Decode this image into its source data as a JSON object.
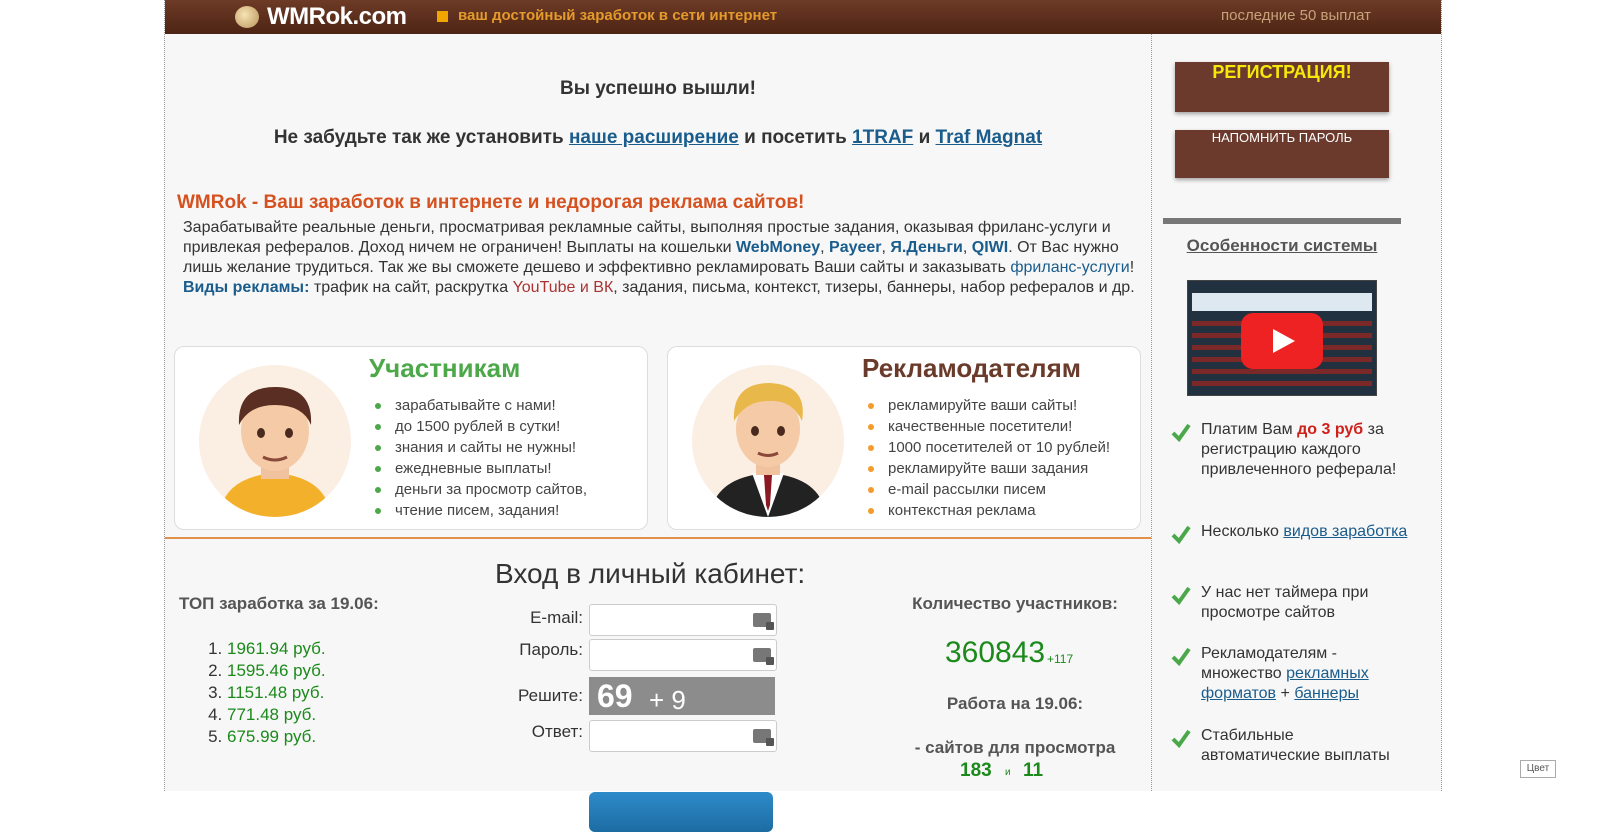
{
  "header": {
    "logo": "WMRok.com",
    "tagline": "ваш достойный заработок в сети интернет",
    "payouts_link": "последние 50 выплат"
  },
  "notice": {
    "logout": "Вы успешно вышли!",
    "remind_pre": "Не забудьте так же установить",
    "ext_link": "наше расширение",
    "mid": "и посетить",
    "link_1traf": "1TRAF",
    "and": "и",
    "link_trafmagnat": "Traf Magnat"
  },
  "intro": {
    "headline": "WMRok - Ваш заработок в интернете и недорогая реклама сайтов!",
    "p1": "Зарабатывайте реальные деньги, просматривая рекламные сайты, выполняя простые задания, оказывая фриланс-услуги и привлекая рефералов. Доход ничем не ограничен! Выплаты на кошельки",
    "wallets": [
      "WebMoney",
      "Payeer",
      "Я.Деньги",
      "QIWI"
    ],
    "p1_end": ". От Вас нужно лишь желание трудиться. Так же вы сможете дешево и эффективно рекламировать Ваши сайты и заказывать",
    "freelance_link": "фриланс-услуги",
    "excl": "!",
    "ad_types_link": "Виды рекламы:",
    "ad_types_text1": "трафик на сайт, раскрутка",
    "ad_types_yt": "YouTube и ВК",
    "ad_types_text2": ", задания, письма, контекст, тизеры, баннеры, набор рефералов и др."
  },
  "cards": {
    "participants": {
      "title": "Участникам",
      "items": [
        "зарабатывайте с нами!",
        "до 1500 рублей в сутки!",
        "знания и сайты не нужны!",
        "ежедневные выплаты!",
        "деньги за просмотр сайтов,",
        "чтение писем, задания!"
      ]
    },
    "advertisers": {
      "title": "Рекламодателям",
      "items": [
        "рекламируйте ваши сайты!",
        "качественные посетители!",
        "1000 посетителей от 10 рублей!",
        "рекламируйте ваши задания",
        "e-mail рассылки писем",
        "контекстная реклама"
      ]
    }
  },
  "top": {
    "title": "ТОП заработка за 19.06:",
    "items": [
      "1961.94 руб.",
      "1595.46 руб.",
      "1151.48 руб.",
      "771.48 руб.",
      "675.99 руб."
    ]
  },
  "login": {
    "title": "Вход в личный кабинет:",
    "email_label": "E-mail:",
    "password_label": "Пароль:",
    "solve_label": "Решите:",
    "answer_label": "Ответ:",
    "captcha_a": "69",
    "captcha_b": "+ 9"
  },
  "stats": {
    "members_title": "Количество участников:",
    "members": "360843",
    "members_delta": "+117",
    "work_title": "Работа на 19.06:",
    "sites_label": "- сайтов для просмотра",
    "sites_a": "183",
    "sites_sep": "и",
    "sites_b": "11"
  },
  "sidebar": {
    "register": "РЕГИСТРАЦИЯ!",
    "remind_password": "НАПОМНИТЬ ПАРОЛЬ",
    "features_title": "Особенности системы",
    "features": {
      "f1_pre": "Платим Вам",
      "f1_red": "до 3 руб",
      "f1_post": "за регистрацию каждого привлеченного реферала!",
      "f2_pre": "Несколько",
      "f2_link": "видов заработка",
      "f3": "У нас нет таймера при просмотре сайтов",
      "f4_pre": "Рекламодателям - множество",
      "f4_link1": "рекламных форматов",
      "f4_plus": "+",
      "f4_link2": "баннеры",
      "f5": "Стабильные автоматические выплаты"
    }
  },
  "color_button": "Цвет"
}
